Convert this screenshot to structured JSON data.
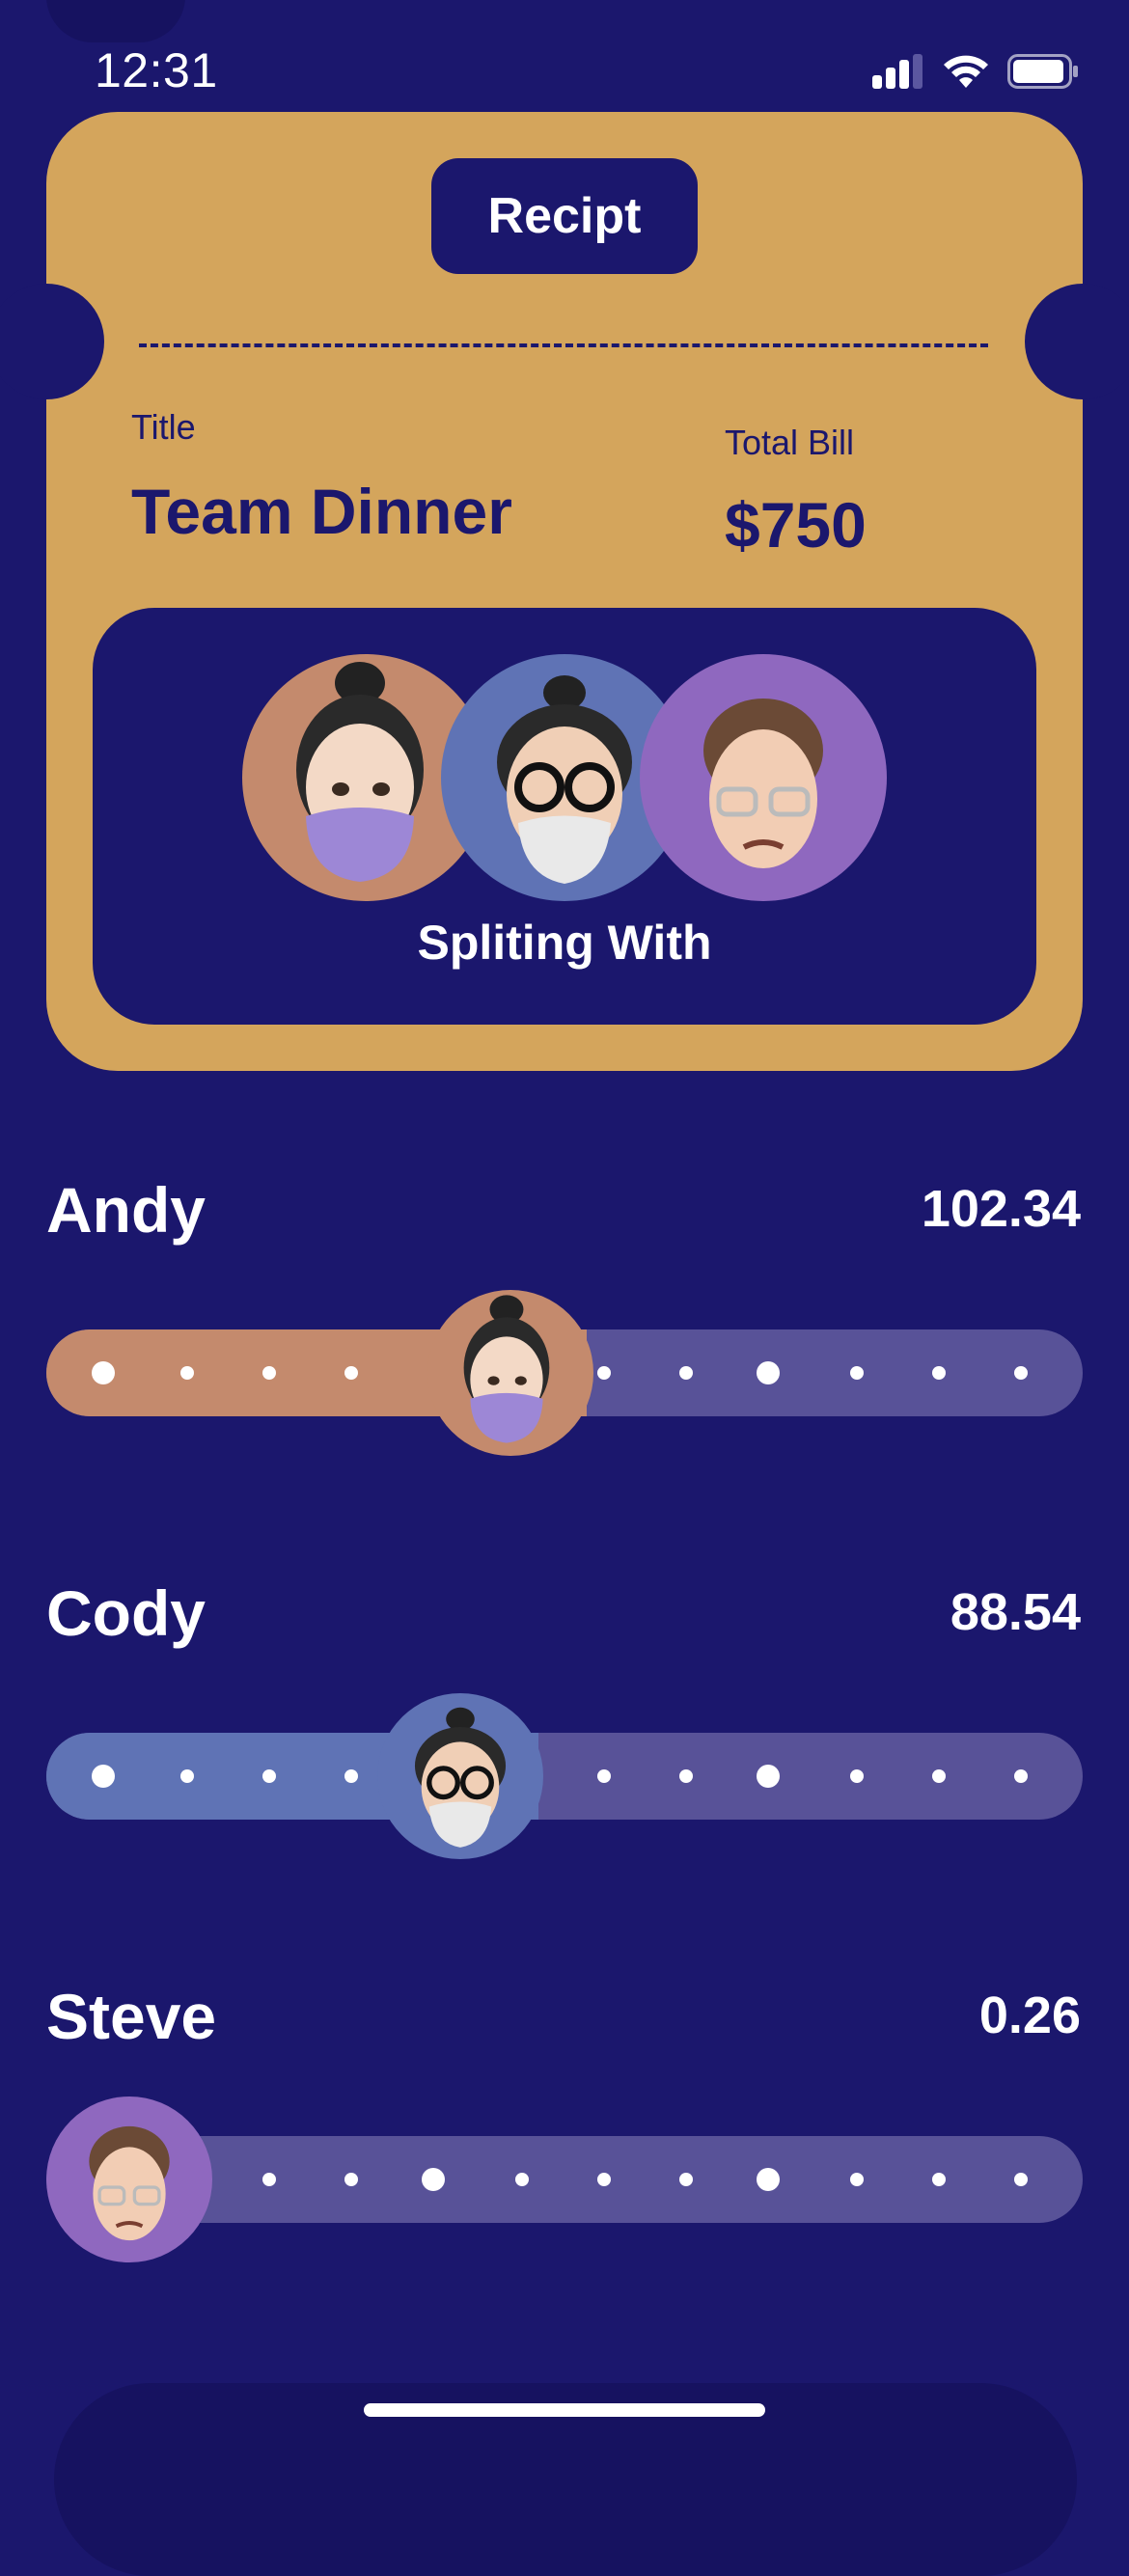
{
  "status": {
    "time": "12:31"
  },
  "ticket": {
    "button_label": "Recipt",
    "title_label": "Title",
    "title_value": "Team Dinner",
    "bill_label": "Total Bill",
    "bill_value": "$750",
    "split_label": "Spliting With"
  },
  "people": [
    {
      "name": "Andy",
      "amount": "102.34",
      "color": "#c48a6d",
      "avatar": "masked-woman-avatar"
    },
    {
      "name": "Cody",
      "amount": "88.54",
      "color": "#5f73b5",
      "avatar": "glasses-man-avatar"
    },
    {
      "name": "Steve",
      "amount": "0.26",
      "color": "#8f68bf",
      "avatar": "brown-hair-man-avatar"
    }
  ],
  "colors": {
    "background": "#1b176d",
    "ticket": "#d4a55c",
    "track": "#585298"
  }
}
